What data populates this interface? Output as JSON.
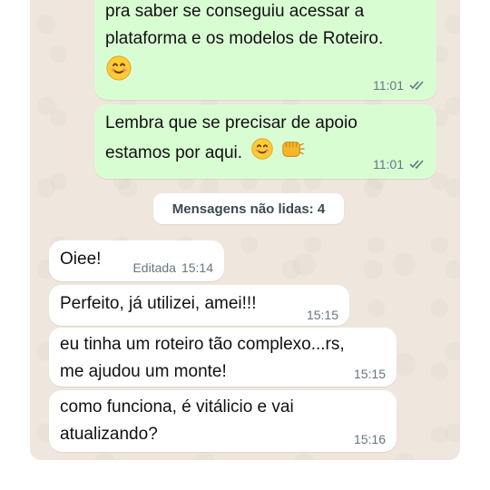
{
  "colors": {
    "outgoing_bubble": "#d9fdd3",
    "incoming_bubble": "#ffffff",
    "chat_background": "#efe7dd",
    "meta_text": "#667781"
  },
  "messages_out": [
    {
      "text": "pra saber se conseguiu acessar a\nplataforma e os modelos de Roteiro.",
      "emoji": "smiling-face-icon",
      "time": "11:01",
      "status_icon": "double-check-icon"
    },
    {
      "text": "Lembra que se precisar de apoio\nestamos por aqui.",
      "emoji": [
        "smiling-face-icon",
        "fist-bump-icon"
      ],
      "time": "11:01",
      "status_icon": "double-check-icon"
    }
  ],
  "unread_divider": {
    "label": "Mensagens não lidas: 4"
  },
  "messages_in": [
    {
      "text": "Oiee!",
      "edited_label": "Editada",
      "time": "15:14"
    },
    {
      "text": "Perfeito, já utilizei, amei!!!",
      "time": "15:15"
    },
    {
      "text": "eu tinha um roteiro tão complexo...rs,\nme ajudou um monte!",
      "time": "15:15"
    },
    {
      "text": "como funciona, é vitálicio e vai\natualizando?",
      "time": "15:16"
    }
  ]
}
